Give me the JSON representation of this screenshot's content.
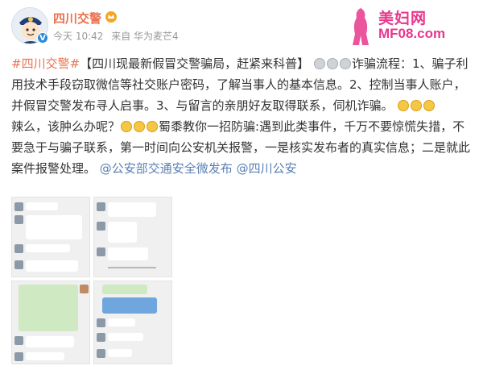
{
  "account": {
    "name": "四川交警",
    "avatar_icon": "police-avatar-icon",
    "verified_icon": "verified-v-icon",
    "vip_icon": "crown-icon",
    "time": "今天 10:42",
    "source": "来自 华为麦芒4"
  },
  "watermark": {
    "site_name": "美妇网",
    "site_domain": "MF08.com"
  },
  "post": {
    "hashtag": "#四川交警#",
    "headline": "【四川现最新假冒交警骗局，赶紧来科普】",
    "para1_rest": "诈骗流程：1、骗子利用技术手段窃取微信等社交账户密码，了解当事人的基本信息。2、控制当事人账户，并假冒交警发布寻人启事。3、与留言的亲朋好友取得联系，伺机诈骗。",
    "para2_start": "辣么，该肿么办呢？",
    "para2_rest": "蜀黍教你一招防骗:遇到此类事件，千万不要惊慌失措，不要急于与骗子联系，第一时间向公安机关报警，一是核实发布者的真实信息；二是就此案件报警处理。",
    "mention1": "@公安部交通安全微发布",
    "mention2": "@四川公安"
  },
  "colors": {
    "link": "#eb7350",
    "mention": "#5a7fb5",
    "watermark": "#e8378d"
  }
}
